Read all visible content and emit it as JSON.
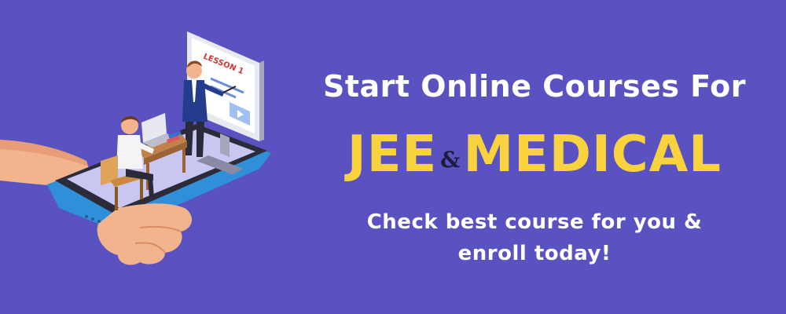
{
  "banner": {
    "headline": "Start Online Courses For",
    "exam_primary": "JEE",
    "ampersand": "&",
    "exam_secondary": "MEDICAL",
    "subline_1": "Check best course for you &",
    "subline_2": "enroll today!",
    "illustration": {
      "icon": "phone-classroom-illustration",
      "screen_label": "LESSON 1"
    },
    "colors": {
      "background": "#5A52C1",
      "accent": "#F9D33E",
      "text": "#FFFFFF"
    }
  }
}
